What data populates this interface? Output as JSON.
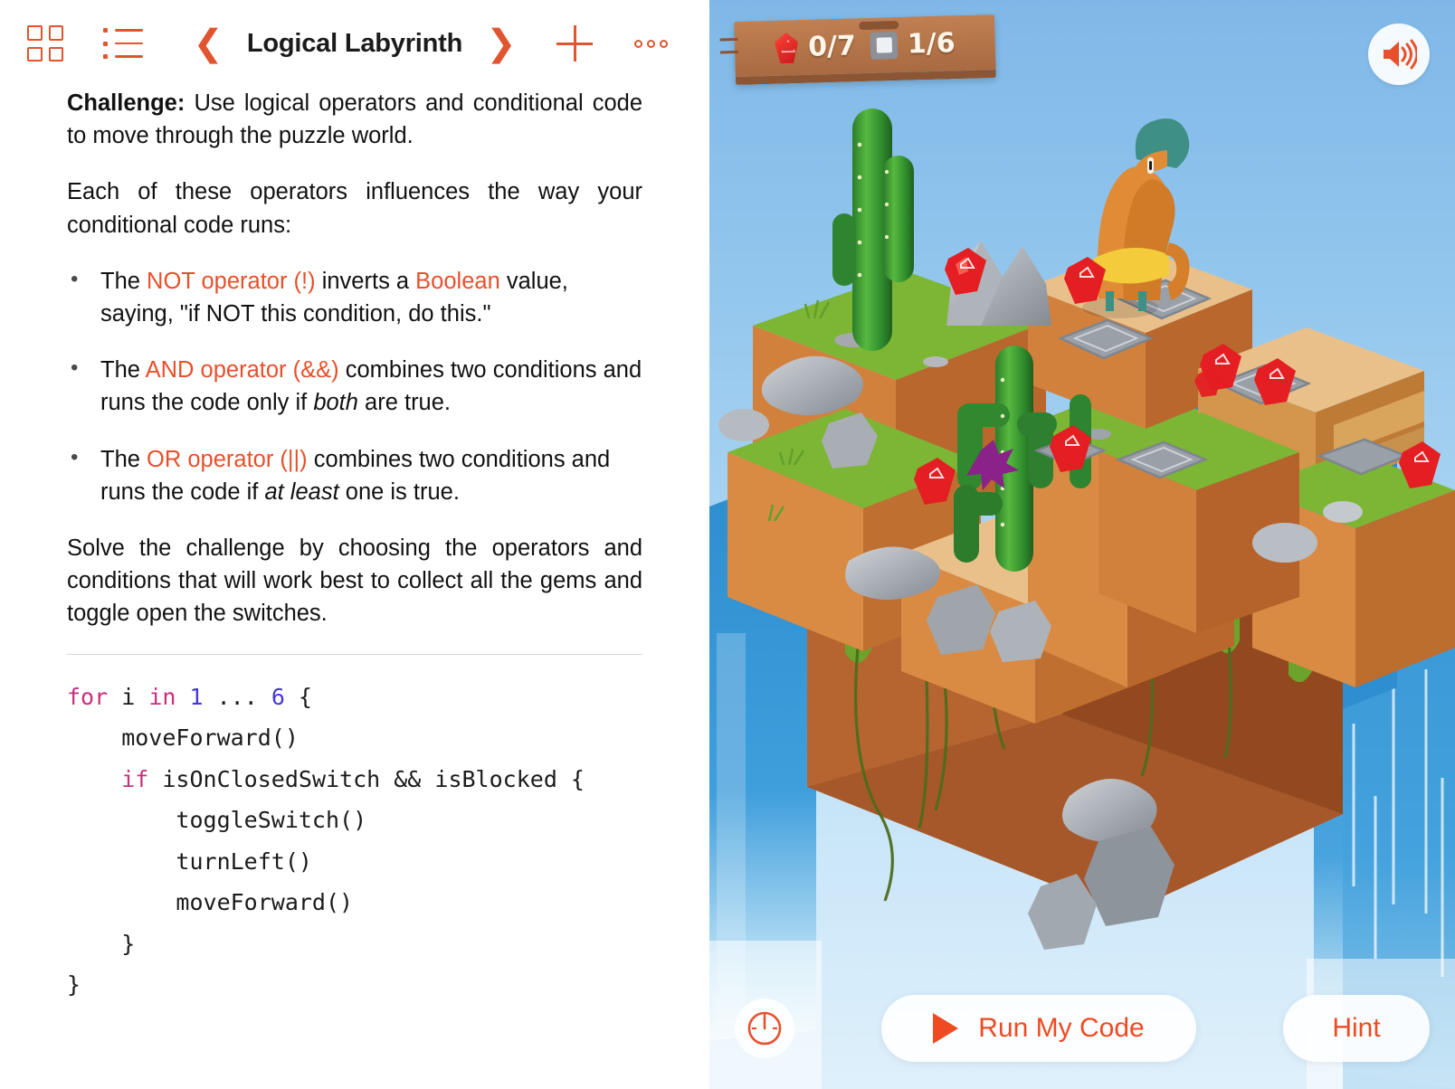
{
  "toolbar": {
    "grid_icon": "grid-view-icon",
    "list_icon": "list-view-icon",
    "prev_icon": "chevron-left-icon",
    "next_icon": "chevron-right-icon",
    "title": "Logical Labyrinth",
    "add_icon": "plus-icon",
    "more_icon": "more-options-icon"
  },
  "content": {
    "challenge_label": "Challenge:",
    "challenge_text": " Use logical operators and conditional code to move through the puzzle world.",
    "intro": "Each of these operators influences the way your conditional code runs:",
    "operators": [
      {
        "pre": "The ",
        "name": "NOT operator (!)",
        "mid": " inverts a ",
        "name2": "Boolean",
        "post": " value, saying, \"if NOT this condition, do this.\""
      },
      {
        "pre": "The ",
        "name": "AND operator (&&)",
        "mid": " combines two conditions and runs the code only if ",
        "em": "both",
        "post": " are true."
      },
      {
        "pre": "The ",
        "name": "OR operator (||)",
        "mid": " combines two conditions and runs the code if ",
        "em": "at least",
        "post": " one is true."
      }
    ],
    "solve": "Solve the challenge by choosing the operators and conditions that will work best to collect all the gems and toggle open the switches."
  },
  "code": {
    "lines": [
      [
        {
          "t": "for",
          "c": "k"
        },
        {
          "t": " i ",
          "c": ""
        },
        {
          "t": "in",
          "c": "k"
        },
        {
          "t": " ",
          "c": ""
        },
        {
          "t": "1",
          "c": "n"
        },
        {
          "t": " ... ",
          "c": ""
        },
        {
          "t": "6",
          "c": "n"
        },
        {
          "t": " {",
          "c": ""
        }
      ],
      [
        {
          "t": "    moveForward()",
          "c": ""
        }
      ],
      [
        {
          "t": "    ",
          "c": ""
        },
        {
          "t": "if",
          "c": "k"
        },
        {
          "t": " isOnClosedSwitch && isBlocked {",
          "c": ""
        }
      ],
      [
        {
          "t": "        toggleSwitch()",
          "c": ""
        }
      ],
      [
        {
          "t": "        turnLeft()",
          "c": ""
        }
      ],
      [
        {
          "t": "        moveForward()",
          "c": ""
        }
      ],
      [
        {
          "t": "    }",
          "c": ""
        }
      ],
      [
        {
          "t": "}",
          "c": ""
        }
      ]
    ]
  },
  "game": {
    "hud": {
      "gem_icon": "gem-icon",
      "gem_count": "0/7",
      "switch_icon": "switch-tile-icon",
      "switch_count": "1/6"
    },
    "sound_icon": "speaker-on-icon",
    "speed_icon": "speed-gauge-icon",
    "run_label": "Run My Code",
    "run_icon": "play-triangle-icon",
    "hint_label": "Hint"
  },
  "colors": {
    "accent": "#E0552F",
    "run_accent": "#EE4B22",
    "code_keyword": "#C9307E",
    "code_number": "#4438D6",
    "sky_top": "#7FB8E8",
    "sky_bottom": "#DFF0FB",
    "terrain_orange": "#E0883F",
    "grass_green": "#6BAE2E",
    "water_blue": "#2F8ED0",
    "gem_red": "#D4211E",
    "rock_gray": "#9AA0A7",
    "character_body": "#E08B35",
    "character_head": "#3E8F86"
  }
}
